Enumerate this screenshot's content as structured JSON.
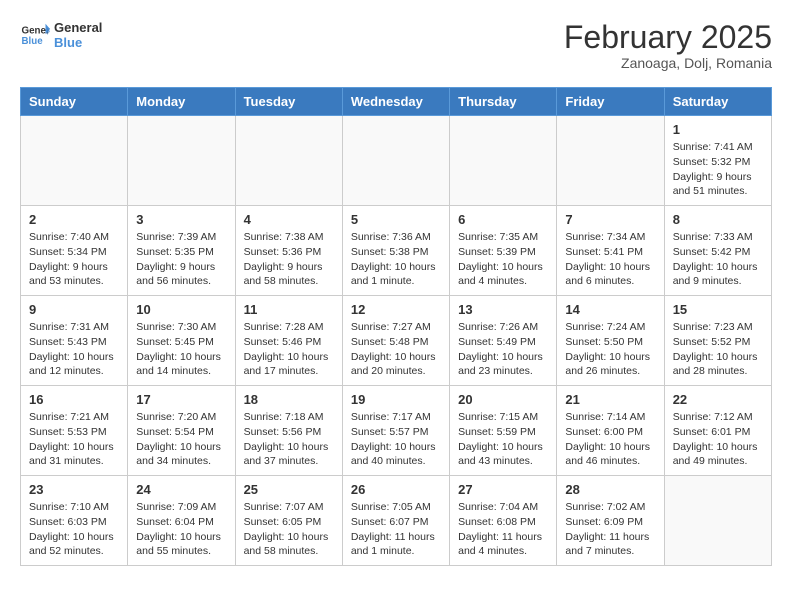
{
  "header": {
    "logo_line1": "General",
    "logo_line2": "Blue",
    "month": "February 2025",
    "location": "Zanoaga, Dolj, Romania"
  },
  "weekdays": [
    "Sunday",
    "Monday",
    "Tuesday",
    "Wednesday",
    "Thursday",
    "Friday",
    "Saturday"
  ],
  "weeks": [
    [
      {
        "day": "",
        "info": ""
      },
      {
        "day": "",
        "info": ""
      },
      {
        "day": "",
        "info": ""
      },
      {
        "day": "",
        "info": ""
      },
      {
        "day": "",
        "info": ""
      },
      {
        "day": "",
        "info": ""
      },
      {
        "day": "1",
        "info": "Sunrise: 7:41 AM\nSunset: 5:32 PM\nDaylight: 9 hours and 51 minutes."
      }
    ],
    [
      {
        "day": "2",
        "info": "Sunrise: 7:40 AM\nSunset: 5:34 PM\nDaylight: 9 hours and 53 minutes."
      },
      {
        "day": "3",
        "info": "Sunrise: 7:39 AM\nSunset: 5:35 PM\nDaylight: 9 hours and 56 minutes."
      },
      {
        "day": "4",
        "info": "Sunrise: 7:38 AM\nSunset: 5:36 PM\nDaylight: 9 hours and 58 minutes."
      },
      {
        "day": "5",
        "info": "Sunrise: 7:36 AM\nSunset: 5:38 PM\nDaylight: 10 hours and 1 minute."
      },
      {
        "day": "6",
        "info": "Sunrise: 7:35 AM\nSunset: 5:39 PM\nDaylight: 10 hours and 4 minutes."
      },
      {
        "day": "7",
        "info": "Sunrise: 7:34 AM\nSunset: 5:41 PM\nDaylight: 10 hours and 6 minutes."
      },
      {
        "day": "8",
        "info": "Sunrise: 7:33 AM\nSunset: 5:42 PM\nDaylight: 10 hours and 9 minutes."
      }
    ],
    [
      {
        "day": "9",
        "info": "Sunrise: 7:31 AM\nSunset: 5:43 PM\nDaylight: 10 hours and 12 minutes."
      },
      {
        "day": "10",
        "info": "Sunrise: 7:30 AM\nSunset: 5:45 PM\nDaylight: 10 hours and 14 minutes."
      },
      {
        "day": "11",
        "info": "Sunrise: 7:28 AM\nSunset: 5:46 PM\nDaylight: 10 hours and 17 minutes."
      },
      {
        "day": "12",
        "info": "Sunrise: 7:27 AM\nSunset: 5:48 PM\nDaylight: 10 hours and 20 minutes."
      },
      {
        "day": "13",
        "info": "Sunrise: 7:26 AM\nSunset: 5:49 PM\nDaylight: 10 hours and 23 minutes."
      },
      {
        "day": "14",
        "info": "Sunrise: 7:24 AM\nSunset: 5:50 PM\nDaylight: 10 hours and 26 minutes."
      },
      {
        "day": "15",
        "info": "Sunrise: 7:23 AM\nSunset: 5:52 PM\nDaylight: 10 hours and 28 minutes."
      }
    ],
    [
      {
        "day": "16",
        "info": "Sunrise: 7:21 AM\nSunset: 5:53 PM\nDaylight: 10 hours and 31 minutes."
      },
      {
        "day": "17",
        "info": "Sunrise: 7:20 AM\nSunset: 5:54 PM\nDaylight: 10 hours and 34 minutes."
      },
      {
        "day": "18",
        "info": "Sunrise: 7:18 AM\nSunset: 5:56 PM\nDaylight: 10 hours and 37 minutes."
      },
      {
        "day": "19",
        "info": "Sunrise: 7:17 AM\nSunset: 5:57 PM\nDaylight: 10 hours and 40 minutes."
      },
      {
        "day": "20",
        "info": "Sunrise: 7:15 AM\nSunset: 5:59 PM\nDaylight: 10 hours and 43 minutes."
      },
      {
        "day": "21",
        "info": "Sunrise: 7:14 AM\nSunset: 6:00 PM\nDaylight: 10 hours and 46 minutes."
      },
      {
        "day": "22",
        "info": "Sunrise: 7:12 AM\nSunset: 6:01 PM\nDaylight: 10 hours and 49 minutes."
      }
    ],
    [
      {
        "day": "23",
        "info": "Sunrise: 7:10 AM\nSunset: 6:03 PM\nDaylight: 10 hours and 52 minutes."
      },
      {
        "day": "24",
        "info": "Sunrise: 7:09 AM\nSunset: 6:04 PM\nDaylight: 10 hours and 55 minutes."
      },
      {
        "day": "25",
        "info": "Sunrise: 7:07 AM\nSunset: 6:05 PM\nDaylight: 10 hours and 58 minutes."
      },
      {
        "day": "26",
        "info": "Sunrise: 7:05 AM\nSunset: 6:07 PM\nDaylight: 11 hours and 1 minute."
      },
      {
        "day": "27",
        "info": "Sunrise: 7:04 AM\nSunset: 6:08 PM\nDaylight: 11 hours and 4 minutes."
      },
      {
        "day": "28",
        "info": "Sunrise: 7:02 AM\nSunset: 6:09 PM\nDaylight: 11 hours and 7 minutes."
      },
      {
        "day": "",
        "info": ""
      }
    ]
  ]
}
